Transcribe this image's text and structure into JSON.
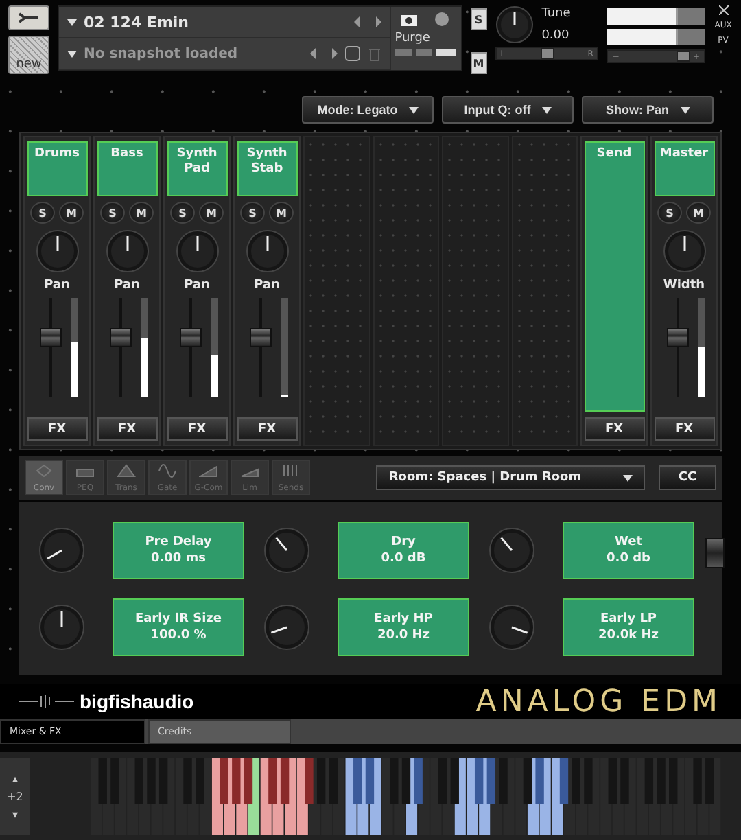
{
  "header": {
    "instrument": "02 124 Emin",
    "snapshot": "No snapshot loaded",
    "purge": "Purge",
    "new_label": "new",
    "solo": "S",
    "mute": "M",
    "tune_label": "Tune",
    "tune_value": "0.00",
    "pan_left": "L",
    "pan_right": "R",
    "aux": "AUX",
    "pv": "PV",
    "vol_minus": "−",
    "vol_plus": "+",
    "pan": {
      "level": 0.5
    },
    "volume": {
      "level": 0.78
    }
  },
  "modes": [
    "Mode: Legato",
    "Input Q: off",
    "Show: Pan"
  ],
  "channels": [
    {
      "kind": "strip",
      "name": "Drums",
      "solo": "S",
      "mute": "M",
      "knob_label": "Pan",
      "fader": {
        "level": 0.62
      },
      "meter": {
        "level": 0.55
      },
      "fx": "FX"
    },
    {
      "kind": "strip",
      "name": "Bass",
      "solo": "S",
      "mute": "M",
      "knob_label": "Pan",
      "fader": {
        "level": 0.62
      },
      "meter": {
        "level": 0.6
      },
      "fx": "FX"
    },
    {
      "kind": "strip",
      "name": "Synth Pad",
      "solo": "S",
      "mute": "M",
      "knob_label": "Pan",
      "fader": {
        "level": 0.62
      },
      "meter": {
        "level": 0.42
      },
      "fx": "FX"
    },
    {
      "kind": "strip",
      "name": "Synth Stab",
      "solo": "S",
      "mute": "M",
      "knob_label": "Pan",
      "fader": {
        "level": 0.62
      },
      "meter": {
        "level": 0
      },
      "fx": "FX"
    },
    {
      "kind": "empty"
    },
    {
      "kind": "empty"
    },
    {
      "kind": "empty"
    },
    {
      "kind": "empty"
    },
    {
      "kind": "send",
      "name": "Send",
      "fx": "FX"
    },
    {
      "kind": "strip",
      "name": "Master",
      "solo": "S",
      "mute": "M",
      "knob_label": "Width",
      "fader": {
        "level": 0.62
      },
      "meter": {
        "level": 0.5
      },
      "fx": "FX"
    }
  ],
  "effects": [
    {
      "label": "Conv",
      "selected": true
    },
    {
      "label": "PEQ",
      "selected": false
    },
    {
      "label": "Trans",
      "selected": false
    },
    {
      "label": "Gate",
      "selected": false
    },
    {
      "label": "G-Com",
      "selected": false
    },
    {
      "label": "Lim",
      "selected": false
    },
    {
      "label": "Sends",
      "selected": false
    }
  ],
  "preset": "Room: Spaces | Drum Room",
  "cc": "CC",
  "params": [
    [
      {
        "name": "Pre Delay",
        "value": "0.00 ms"
      },
      {
        "name": "Dry",
        "value": "0.0 dB"
      },
      {
        "name": "Wet",
        "value": "0.0 db"
      }
    ],
    [
      {
        "name": "Early IR Size",
        "value": "100.0 %"
      },
      {
        "name": "Early HP",
        "value": "20.0 Hz"
      },
      {
        "name": "Early LP",
        "value": "20.0k Hz"
      }
    ]
  ],
  "param_slider": {
    "level": 0.85
  },
  "brand": "bigfishaudio",
  "product": "ANALOG EDM",
  "tabs": [
    {
      "label": "Mixer & FX",
      "selected": true
    },
    {
      "label": "Credits",
      "selected": false
    }
  ],
  "keyboard": {
    "up": "▴",
    "octave": "+2",
    "down": "▾"
  }
}
